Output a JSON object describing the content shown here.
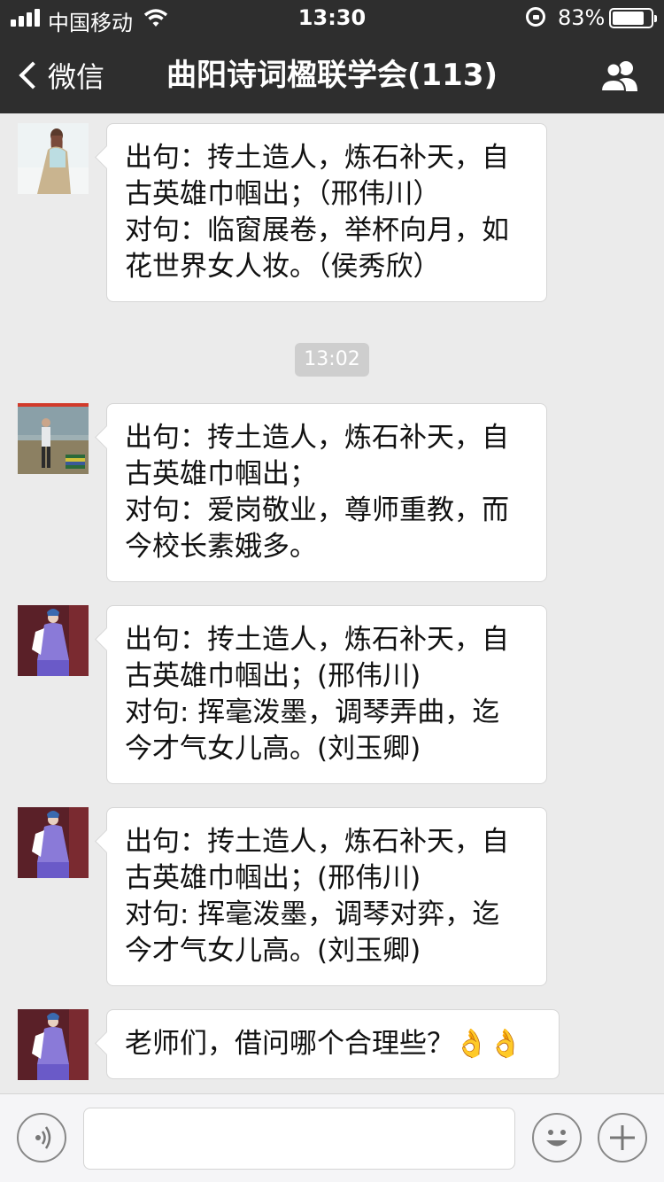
{
  "status_bar": {
    "carrier": "中国移动",
    "time": "13:30",
    "battery_percent": "83%",
    "battery_level": 0.83
  },
  "nav": {
    "back_label": "微信",
    "title": "曲阳诗词楹联学会(113)",
    "members_icon": "group-icon"
  },
  "messages": [
    {
      "lines": [
        "出句：抟土造人，炼石补天，自",
        "古英雄巾帼出；（邢伟川）",
        "对句：临窗展卷，举杯向月，如",
        "花世界女人妆。（侯秀欣）"
      ]
    },
    {
      "lines": [
        "出句：抟土造人，炼石补天，自",
        "古英雄巾帼出；",
        "对句：爱岗敬业，尊师重教，而",
        "今校长素娥多。"
      ]
    },
    {
      "lines": [
        "出句：抟土造人，炼石补天，自",
        "古英雄巾帼出；(邢伟川)",
        "对句: 挥毫泼墨，调琴弄曲，迄",
        "今才气女儿高。(刘玉卿)"
      ]
    },
    {
      "lines": [
        "出句：抟土造人，炼石补天，自",
        "古英雄巾帼出；(邢伟川)",
        "对句: 挥毫泼墨，调琴对弈，迄",
        "今才气女儿高。(刘玉卿)"
      ]
    },
    {
      "lines": [
        "老师们，借问哪个合理些？👌👌"
      ]
    }
  ],
  "timestamp": "13:02",
  "input_bar": {
    "voice_icon": "voice-icon",
    "emoji_icon": "emoji-icon",
    "plus_icon": "plus-icon",
    "text_value": ""
  },
  "colors": {
    "header_bg": "#2e2e2e",
    "chat_bg": "#ebebeb",
    "bubble_bg": "#ffffff",
    "timestamp_bg": "#cecece"
  }
}
